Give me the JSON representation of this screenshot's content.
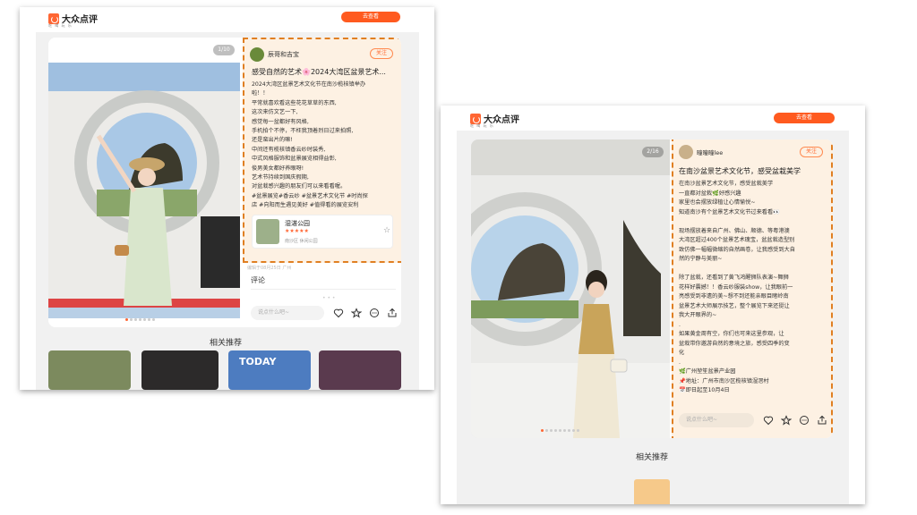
{
  "left": {
    "logo": "大众点评",
    "logo_sub": "吃 喝 玩 乐",
    "go_button": "去查看",
    "counter": "1/10",
    "author": "辰哥和吉宝",
    "follow": "关注",
    "title": "感受自然的艺术🌸2024大湾区盆景艺术...",
    "body": [
      "2024大湾区盆景艺术文化节在南沙榄核镇举办",
      "啦！！",
      "平常就喜欢看这些花花草草的东西,",
      "这次来仿文艺一下,",
      "感觉每一盆都好有风格,",
      "手机拍个不停，不枉我顶着烈日过来拍照,",
      "还是蛮出片的嘛!",
      "中间还有榄核镇香云纱时装秀,",
      "中式风格服饰和盆景展览相得益彰,",
      "俊男美女都好养眼呀!",
      "艺术节持续到国庆假期,",
      "对盆栽感兴趣的朋友们可以来看看喔。",
      "#盆景展览#香云纱 #盆景艺术文化节 #时尚探",
      "店 #向阳而生遇见美好 #值得看的展览安利"
    ],
    "poi_name": "湿湛公园",
    "poi_stars": "★★★★★",
    "poi_meta": "南沙区 休闲公园",
    "date": "编辑于08月25日 广州",
    "comments": "评论",
    "input_placeholder": "说点什么吧~",
    "related": "相关推荐",
    "thumb_today": "TODAY"
  },
  "right": {
    "logo": "大众点评",
    "logo_sub": "吃 喝 玩 乐",
    "go_button": "去查看",
    "counter": "2/16",
    "author": "曈曈曈lee",
    "follow": "关注",
    "title": "在南沙盆景艺术文化节，感受盆栽美学",
    "body": [
      "在南沙盆景艺术文化节，感受盆栽美学",
      "一直都对盆栽🌿好感兴趣",
      "家里也会摆放绿植让心情愉悦~",
      "知道南沙有个盆景艺术文化节过来看看👀",
      "",
      "现场摆放着来自广州、佛山、顺德、等粤港澳",
      "大湾区超过400个盆景艺术瑰宝，盆盆栽造型别",
      "致仿佛一幅幅微缩的自然画卷，让我感受到大自",
      "然的宁静与美丽~",
      "",
      "除了盆栽，还看到了黄飞鸿醒狮队表演~舞狮",
      "花样好震撼！！香云纱服装show，让我眼前一",
      "亮感受到非遗的美~想不到还能亲眼目睹岭南",
      "盆景艺术大师展示技艺，整个展览下来还挺让",
      "我大开眼界的~",
      ".",
      "如果黄金周有空，你们也可来这里参观，让",
      "盆栽带你邀游自然的意境之旅，感受四季的变",
      "化",
      ".",
      "🌿广州堃笙盆景产业园",
      "📌地址：广州市南沙区榄核镇湿滘村",
      "📅即日起至10月4日"
    ],
    "input_placeholder": "说点什么吧~",
    "related": "相关推荐"
  },
  "colors": {
    "accent": "#ff5a1f",
    "highlight_border": "#e07f22",
    "highlight_bg": "#fdf1e3"
  }
}
